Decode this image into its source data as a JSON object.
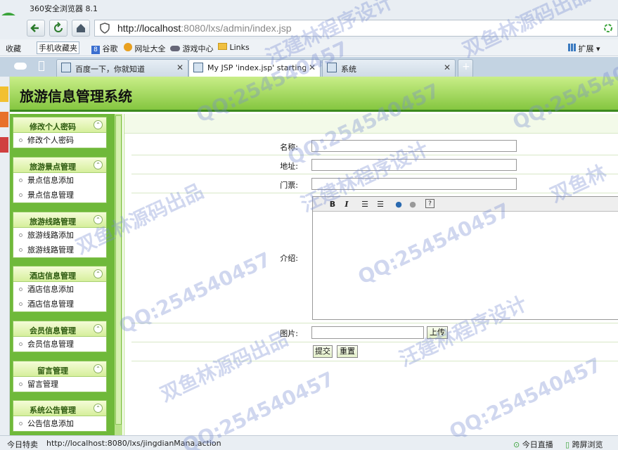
{
  "browser": {
    "title": "360安全浏览器 8.1",
    "url_host": "http://localhost",
    "url_path": ":8080/lxs/admin/index.jsp",
    "bookmarks": [
      "收藏",
      "手机收藏夹",
      "谷歌",
      "网址大全",
      "游戏中心",
      "Links"
    ],
    "extend_label": "扩展",
    "tabs": [
      {
        "label": "百度一下，你就知道"
      },
      {
        "label": "My JSP 'index.jsp' starting p"
      },
      {
        "label": "系统"
      }
    ],
    "status": {
      "left": "今日特卖",
      "url": "http://localhost:8080/lxs/jingdianMana.action",
      "live": "今日直播",
      "split": "跨屏浏览"
    }
  },
  "app": {
    "title": "旅游信息管理系统"
  },
  "sidebar": {
    "groups": [
      {
        "title": "修改个人密码",
        "items": [
          "修改个人密码"
        ]
      },
      {
        "title": "旅游景点管理",
        "items": [
          "景点信息添加",
          "景点信息管理"
        ]
      },
      {
        "title": "旅游线路管理",
        "items": [
          "旅游线路添加",
          "旅游线路管理"
        ]
      },
      {
        "title": "酒店信息管理",
        "items": [
          "酒店信息添加",
          "酒店信息管理"
        ]
      },
      {
        "title": "会员信息管理",
        "items": [
          "会员信息管理"
        ]
      },
      {
        "title": "留言管理",
        "items": [
          "留言管理"
        ]
      },
      {
        "title": "系统公告管理",
        "items": [
          "公告信息添加"
        ]
      }
    ]
  },
  "form": {
    "name_label": "名称:",
    "address_label": "地址:",
    "ticket_label": "门票:",
    "intro_label": "介绍:",
    "image_label": "图片:",
    "upload_label": "上传",
    "submit_label": "提交",
    "reset_label": "重置",
    "name_value": "",
    "address_value": "",
    "ticket_value": ""
  },
  "watermarks": {
    "qq": "QQ:254540457",
    "a": "双鱼林源码出品",
    "b": "汪建林程序设计",
    "c": "双鱼林"
  }
}
